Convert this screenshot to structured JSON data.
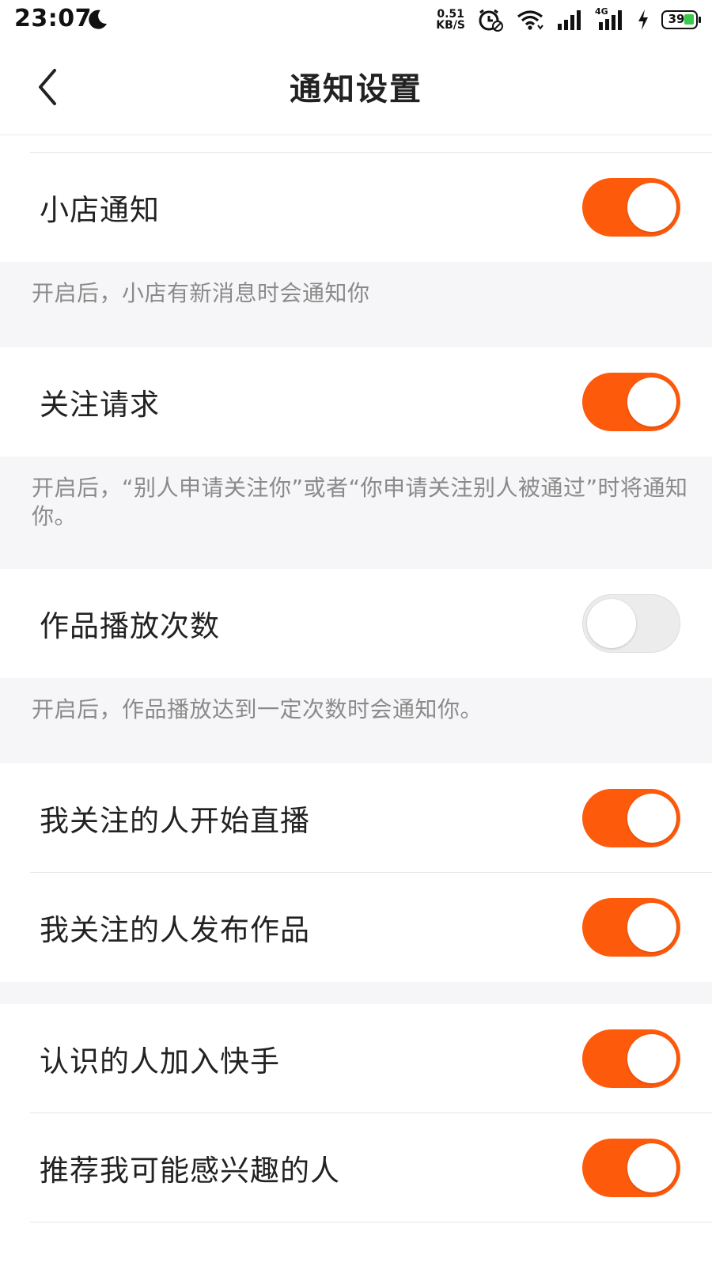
{
  "status_bar": {
    "time": "23:07",
    "net_speed_value": "0.51",
    "net_speed_unit": "KB/S",
    "signal_label": "4G",
    "battery_level": "39"
  },
  "header": {
    "title": "通知设置"
  },
  "settings": [
    {
      "label": "小店通知",
      "enabled": true,
      "description": "开启后，小店有新消息时会通知你"
    },
    {
      "label": "关注请求",
      "enabled": true,
      "description": "开启后，“别人申请关注你”或者“你申请关注别人被通过”时将通知你。"
    },
    {
      "label": "作品播放次数",
      "enabled": false,
      "description": "开启后，作品播放达到一定次数时会通知你。"
    },
    {
      "label": "我关注的人开始直播",
      "enabled": true
    },
    {
      "label": "我关注的人发布作品",
      "enabled": true
    },
    {
      "label": "认识的人加入快手",
      "enabled": true
    },
    {
      "label": "推荐我可能感兴趣的人",
      "enabled": true
    }
  ],
  "colors": {
    "accent": "#fe5a0c",
    "toggle_off": "#ececec",
    "section_bg": "#f6f6f8"
  }
}
